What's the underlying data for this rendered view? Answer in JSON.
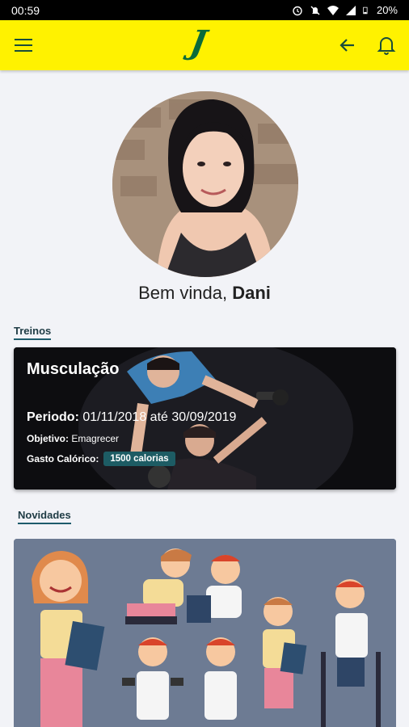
{
  "status_bar": {
    "time": "00:59",
    "battery": "20%"
  },
  "app_bar": {
    "logo_text": "J",
    "brand_color": "#fff200",
    "icons": [
      "menu-icon",
      "back-arrow-icon",
      "bell-icon"
    ]
  },
  "profile": {
    "greeting": "Bem vinda, ",
    "name": "Dani"
  },
  "sections": {
    "treinos": "Treinos",
    "novidades": "Novidades"
  },
  "treino_card": {
    "title": "Musculação",
    "periodo_label": "Periodo:",
    "periodo_value": " 01/11/2018 até 30/09/2019",
    "objetivo_label": "Objetivo:",
    "objetivo_value": " Emagrecer",
    "gasto_label": "Gasto Calórico:",
    "calorias": "1500 calorias"
  },
  "colors": {
    "accent": "#1d5c64",
    "background": "#f2f3f7",
    "news_bg": "#6d7b93"
  }
}
